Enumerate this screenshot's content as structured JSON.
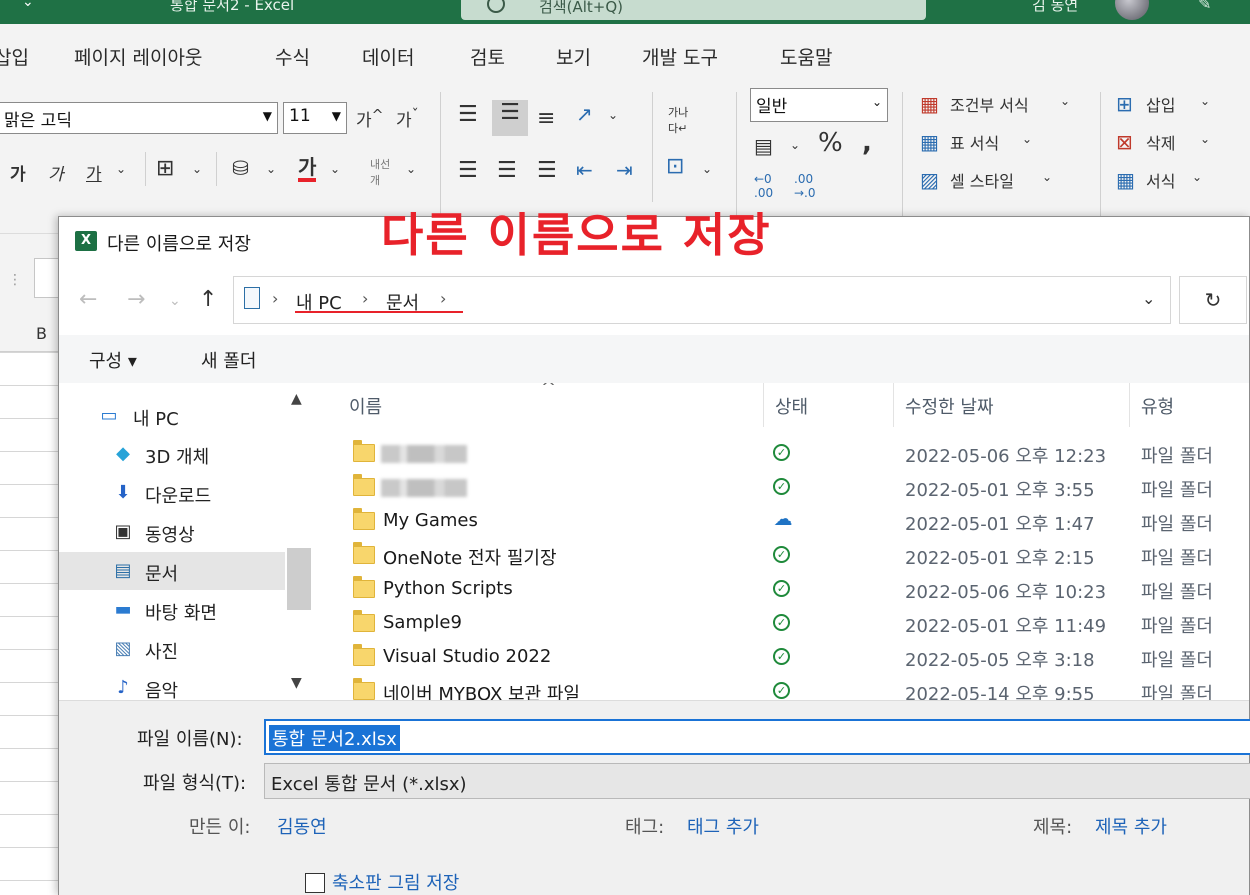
{
  "titlebar": {
    "doc_title": "통합 문서2 - Excel",
    "search": "검색(Alt+Q)",
    "user": "김 동연"
  },
  "ribbon_tabs": [
    "삽입",
    "페이지 레이아웃",
    "수식",
    "데이터",
    "검토",
    "보기",
    "개발 도구",
    "도움말"
  ],
  "ribbon": {
    "font_name": "맑은 고딕",
    "font_size": "11",
    "number_format": "일반",
    "styles": [
      "조건부 서식",
      "표 서식",
      "셀 스타일"
    ],
    "cells": [
      "삽입",
      "삭제",
      "서식"
    ]
  },
  "grid": {
    "column_b": "B"
  },
  "annotation": "다른 이름으로 저장",
  "dialog": {
    "title": "다른 이름으로 저장",
    "breadcrumb": [
      "내 PC",
      "문서"
    ],
    "commands": {
      "organize": "구성 ▾",
      "new_folder": "새 폴더"
    },
    "nav_items": [
      {
        "label": "내 PC",
        "icon": "pc-icon"
      },
      {
        "label": "3D 개체",
        "icon": "cube-icon"
      },
      {
        "label": "다운로드",
        "icon": "download-icon"
      },
      {
        "label": "동영상",
        "icon": "video-icon"
      },
      {
        "label": "문서",
        "icon": "document-icon"
      },
      {
        "label": "바탕 화면",
        "icon": "desktop-icon"
      },
      {
        "label": "사진",
        "icon": "picture-icon"
      },
      {
        "label": "음악",
        "icon": "music-icon"
      }
    ],
    "columns": {
      "name": "이름",
      "status": "상태",
      "date": "수정한 날짜",
      "type": "유형"
    },
    "files": [
      {
        "name": "",
        "status": "synced",
        "date": "2022-05-06 오후 12:23",
        "type": "파일 폴더"
      },
      {
        "name": "",
        "status": "synced",
        "date": "2022-05-01 오후 3:55",
        "type": "파일 폴더"
      },
      {
        "name": "My Games",
        "status": "cloud",
        "date": "2022-05-01 오후 1:47",
        "type": "파일 폴더"
      },
      {
        "name": "OneNote 전자 필기장",
        "status": "synced",
        "date": "2022-05-01 오후 2:15",
        "type": "파일 폴더"
      },
      {
        "name": "Python Scripts",
        "status": "synced",
        "date": "2022-05-06 오후 10:23",
        "type": "파일 폴더"
      },
      {
        "name": "Sample9",
        "status": "synced",
        "date": "2022-05-01 오후 11:49",
        "type": "파일 폴더"
      },
      {
        "name": "Visual Studio 2022",
        "status": "synced",
        "date": "2022-05-05 오후 3:18",
        "type": "파일 폴더"
      },
      {
        "name": "네이버 MYBOX 보관 파일",
        "status": "synced",
        "date": "2022-05-14 오후 9:55",
        "type": "파일 폴더"
      }
    ],
    "form": {
      "filename_label": "파일 이름(N):",
      "filename_value": "통합 문서2.xlsx",
      "filetype_label": "파일 형식(T):",
      "filetype_value": "Excel 통합 문서 (*.xlsx)",
      "author_label": "만든 이:",
      "author_value": "김동연",
      "tags_label": "태그:",
      "tags_value": "태그 추가",
      "title_label": "제목:",
      "title_value": "제목 추가",
      "thumbnail_label": "축소판 그림 저장"
    }
  },
  "colors": {
    "excel_green": "#1f7145",
    "annotation_red": "#e8222a",
    "link_blue": "#1e63b8",
    "selection_blue": "#1a73d6"
  }
}
